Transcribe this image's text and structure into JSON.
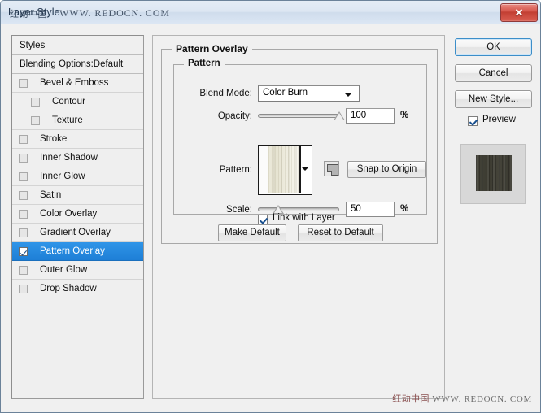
{
  "window": {
    "title": "Layer Style",
    "title_watermark_cn": "红动中国",
    "title_watermark_en": "WWW. REDOCN. COM",
    "close_icon": "close-icon",
    "close_glyph": "✕"
  },
  "sidebar": {
    "header": "Styles",
    "blending_options": "Blending Options:Default",
    "items": [
      {
        "label": "Bevel & Emboss",
        "checked": false,
        "indent": false,
        "selected": false
      },
      {
        "label": "Contour",
        "checked": false,
        "indent": true,
        "selected": false
      },
      {
        "label": "Texture",
        "checked": false,
        "indent": true,
        "selected": false
      },
      {
        "label": "Stroke",
        "checked": false,
        "indent": false,
        "selected": false
      },
      {
        "label": "Inner Shadow",
        "checked": false,
        "indent": false,
        "selected": false
      },
      {
        "label": "Inner Glow",
        "checked": false,
        "indent": false,
        "selected": false
      },
      {
        "label": "Satin",
        "checked": false,
        "indent": false,
        "selected": false
      },
      {
        "label": "Color Overlay",
        "checked": false,
        "indent": false,
        "selected": false
      },
      {
        "label": "Gradient Overlay",
        "checked": false,
        "indent": false,
        "selected": false
      },
      {
        "label": "Pattern Overlay",
        "checked": true,
        "indent": false,
        "selected": true
      },
      {
        "label": "Outer Glow",
        "checked": false,
        "indent": false,
        "selected": false
      },
      {
        "label": "Drop Shadow",
        "checked": false,
        "indent": false,
        "selected": false
      }
    ]
  },
  "main": {
    "group_title": "Pattern Overlay",
    "subgroup_title": "Pattern",
    "blend_mode": {
      "label": "Blend Mode:",
      "value": "Color Burn"
    },
    "opacity": {
      "label": "Opacity:",
      "value": "100",
      "unit": "%",
      "slider_percent": 100
    },
    "pattern": {
      "label": "Pattern:",
      "swatch_icon": "pattern-swatch",
      "dropdown_icon": "chevron-down-icon",
      "new_preset_icon": "new-preset-icon",
      "snap_to_origin": "Snap to Origin"
    },
    "scale": {
      "label": "Scale:",
      "value": "50",
      "unit": "%",
      "slider_percent": 25
    },
    "link_with_layer": {
      "label": "Link with Layer",
      "checked": true
    },
    "make_default": "Make Default",
    "reset_to_default": "Reset to Default"
  },
  "right": {
    "ok": "OK",
    "cancel": "Cancel",
    "new_style": "New Style...",
    "preview": {
      "label": "Preview",
      "checked": true
    },
    "preview_thumbnail_icon": "preview-thumbnail"
  },
  "watermark": {
    "cn": "红动中国",
    "en": "WWW. REDOCN. COM"
  },
  "colors": {
    "selection_blue": "#1e7fd6",
    "title_bar": "#dce6f2",
    "close_red": "#c23f33",
    "dialog_bg": "#f0f0f0",
    "default_button_border": "#3c8ec9"
  }
}
